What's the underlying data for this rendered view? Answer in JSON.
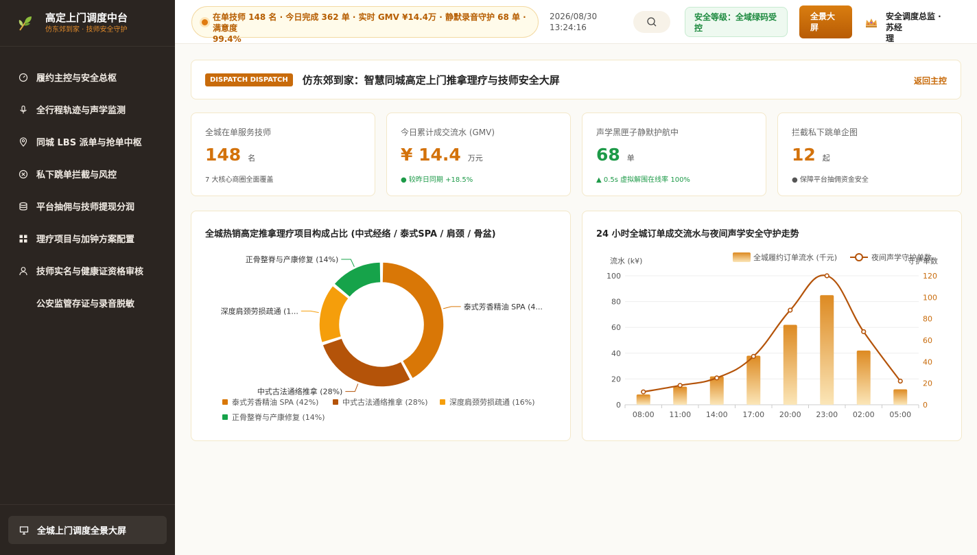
{
  "app": {
    "title": "高定上门调度中台",
    "subtitle": "仿东郊到家 · 技师安全守护"
  },
  "sidebar": {
    "items": [
      {
        "label": "履约主控与安全总枢",
        "icon": "gauge-icon"
      },
      {
        "label": "全行程轨迹与声学监测",
        "icon": "microphone-icon"
      },
      {
        "label": "同城 LBS 派单与抢单中枢",
        "icon": "location-pin-icon"
      },
      {
        "label": "私下跳单拦截与风控",
        "icon": "block-icon"
      },
      {
        "label": "平台抽佣与技师提现分润",
        "icon": "database-icon"
      },
      {
        "label": "理疗项目与加钟方案配置",
        "icon": "grid-icon"
      },
      {
        "label": "技师实名与健康证资格审核",
        "icon": "user-icon"
      },
      {
        "label": "公安监管存证与录音脱敏",
        "icon": ""
      }
    ],
    "bottom_button": "全城上门调度全景大屏"
  },
  "header": {
    "ticker_line1": "在单技师 148 名 · 今日完成 362 单 · 实时 GMV ¥14.4万 · 静默录音守护 68 单 · 满意度",
    "ticker_line2": "99.4%",
    "date": "2026/08/30",
    "time": "13:24:16",
    "safety_line1": "安全等级：全域绿码受",
    "safety_line2": "控",
    "fullscreen_line1": "全景大",
    "fullscreen_line2": "屏",
    "user_line1": "安全调度总监 · 苏经",
    "user_line2": "理"
  },
  "page": {
    "tag": "DISPATCH DISPATCH",
    "title": "仿东郊到家：智慧同城高定上门推拿理疗与技师安全大屏",
    "back": "返回主控"
  },
  "kpis": [
    {
      "label": "全城在单服务技师",
      "value": "148",
      "unit": "名",
      "note": "7 大核心商圈全面覆盖",
      "color": "#d3720b"
    },
    {
      "label": "今日累计成交流水 (GMV)",
      "value": "¥ 14.4",
      "unit": "万元",
      "note": "● 较昨日同期 +18.5%",
      "color": "#d3720b"
    },
    {
      "label": "声学黑匣子静默护航中",
      "value": "68",
      "unit": "单",
      "note": "▲ 0.5s 虚拟解围在线率 100%",
      "color": "#1d9a48"
    },
    {
      "label": "拦截私下跳单企图",
      "value": "12",
      "unit": "起",
      "note": "● 保障平台抽佣资金安全",
      "color": "#d3720b"
    }
  ],
  "chart_data": [
    {
      "type": "pie",
      "title": "全城热销高定推拿理疗项目构成占比 (中式经络 / 泰式SPA / 肩颈 / 骨盆)",
      "categories": [
        "泰式芳香精油 SPA",
        "中式古法通络推拿",
        "深度肩颈劳损疏通",
        "正骨整脊与产康修复"
      ],
      "values": [
        42,
        28,
        16,
        14
      ],
      "colors": [
        "#d97706",
        "#b45309",
        "#f59e0b",
        "#16a34a"
      ],
      "slice_labels": [
        "泰式芳香精油 SPA (4...",
        "中式古法通络推拿 (28%)",
        "深度肩颈劳损疏通 (1...",
        "正骨整脊与产康修复 (14%)"
      ],
      "legend": [
        "泰式芳香精油 SPA (42%)",
        "中式古法通络推拿 (28%)",
        "深度肩颈劳损疏通 (16%)",
        "正骨整脊与产康修复 (14%)"
      ],
      "legend_position": "bottom"
    },
    {
      "type": "bar",
      "title": "24 小时全城订单成交流水与夜间声学安全守护走势",
      "categories": [
        "08:00",
        "11:00",
        "14:00",
        "17:00",
        "20:00",
        "23:00",
        "02:00",
        "05:00"
      ],
      "series": [
        {
          "name": "全城履约订单流水 (千元)",
          "type": "bar",
          "axis": "left",
          "values": [
            8,
            14,
            22,
            38,
            62,
            85,
            42,
            12
          ],
          "color": "#e0952a"
        },
        {
          "name": "夜间声学守护单数",
          "type": "line",
          "axis": "right",
          "values": [
            12,
            18,
            25,
            45,
            88,
            120,
            68,
            22
          ],
          "color": "#b45309"
        }
      ],
      "ylabel": "流水 (k¥)",
      "ylabel_right": "守护单数",
      "ylim": [
        0,
        100
      ],
      "ylim_right": [
        0,
        120
      ],
      "yticks": [
        "0",
        "20",
        "40",
        "60",
        "80",
        "100"
      ],
      "yticks_right": [
        "0",
        "20",
        "40",
        "60",
        "80",
        "100",
        "120"
      ],
      "grid": true,
      "legend_position": "top-right"
    }
  ]
}
